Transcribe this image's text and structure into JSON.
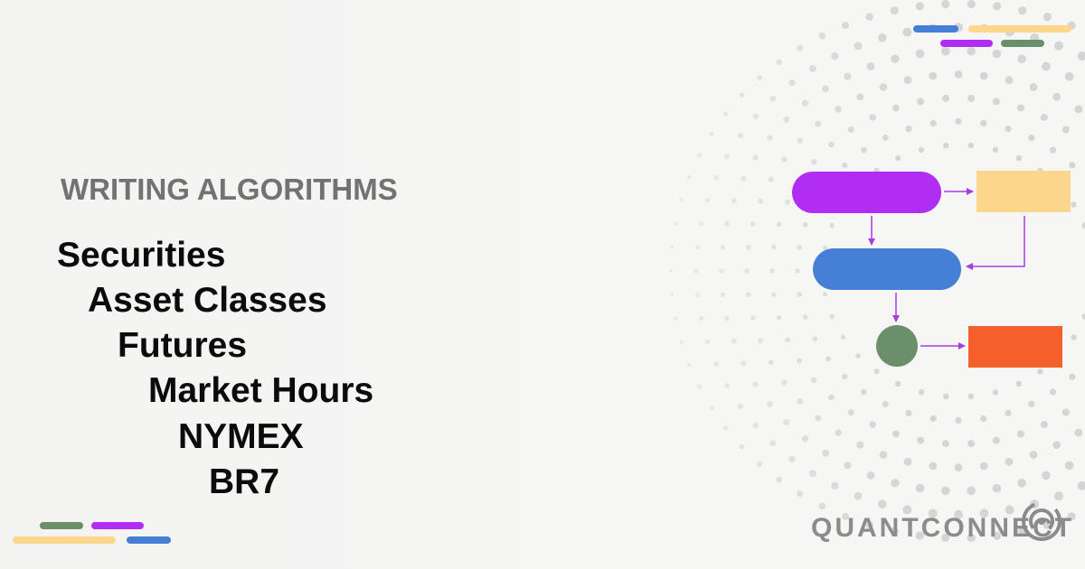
{
  "header": {
    "section_label": "WRITING ALGORITHMS"
  },
  "breadcrumb": [
    "Securities",
    "Asset Classes",
    "Futures",
    "Market Hours",
    "NYMEX",
    "BR7"
  ],
  "brand": {
    "name": "QUANTCONNECT",
    "logo_icon": "quantconnect-logo-icon"
  },
  "colors": {
    "background": "#f4f4f3",
    "label_gray": "#727272",
    "text_black": "#0b0b0b",
    "purple": "#b02ef3",
    "yellow": "#fcd68c",
    "blue": "#4680d6",
    "green": "#6b8e6b",
    "orange": "#f55f2b",
    "arrow": "#a93de0",
    "dot": "#c4c4c4"
  }
}
